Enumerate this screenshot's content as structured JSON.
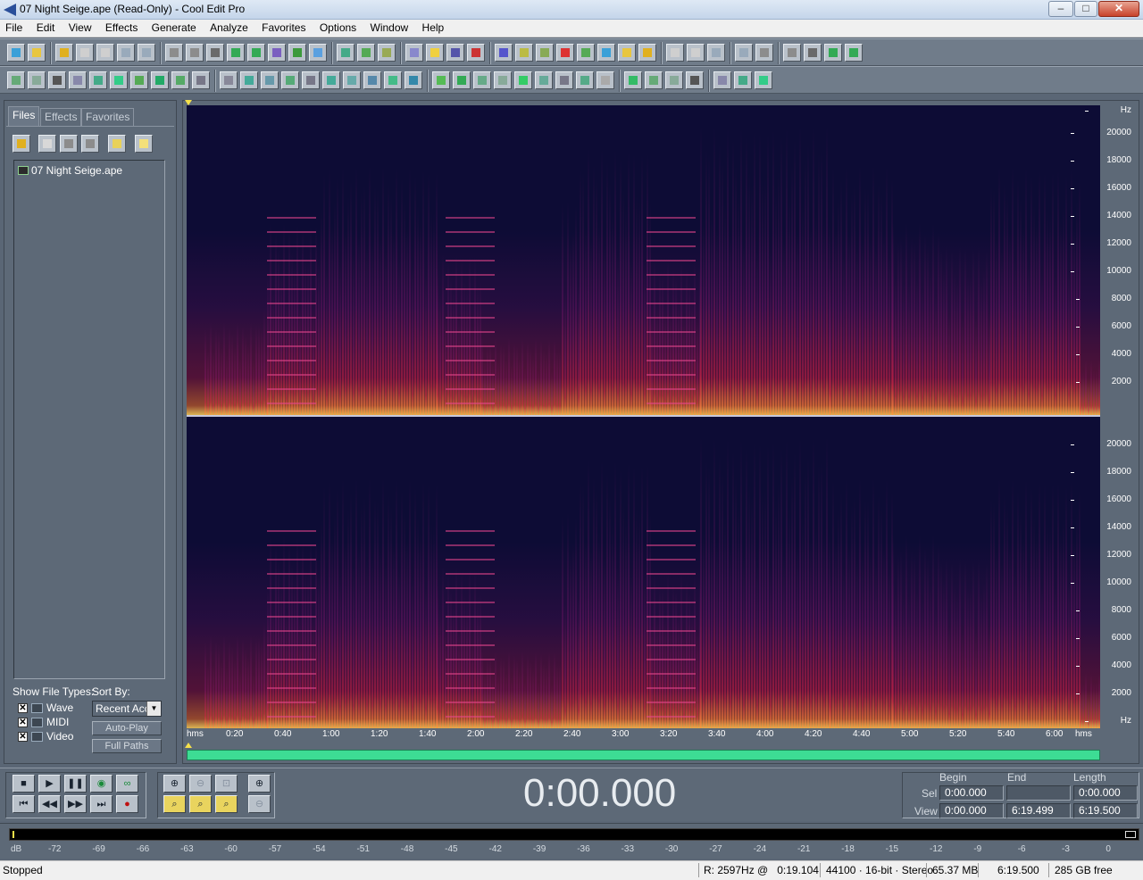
{
  "window": {
    "title": "07 Night Seige.ape (Read-Only) - Cool Edit Pro"
  },
  "menu": [
    "File",
    "Edit",
    "View",
    "Effects",
    "Generate",
    "Analyze",
    "Favorites",
    "Options",
    "Window",
    "Help"
  ],
  "panel": {
    "tabs": [
      "Files",
      "Effects",
      "Favorites"
    ],
    "files": [
      "07 Night Seige.ape"
    ],
    "show_file_types_label": "Show File Types:",
    "sort_by_label": "Sort By:",
    "types": [
      "Wave",
      "MIDI",
      "Video"
    ],
    "sort_value": "Recent Acc",
    "auto_play": "Auto-Play",
    "full_paths": "Full Paths"
  },
  "spectrogram": {
    "hz_labels_top": [
      "Hz",
      "20000",
      "18000",
      "16000",
      "14000",
      "12000",
      "10000",
      "8000",
      "6000",
      "4000",
      "2000"
    ],
    "hz_labels_bottom": [
      "20000",
      "18000",
      "16000",
      "14000",
      "12000",
      "10000",
      "8000",
      "6000",
      "4000",
      "2000",
      "Hz"
    ],
    "time_labels": [
      "hms",
      "0:20",
      "0:40",
      "1:00",
      "1:20",
      "1:40",
      "2:00",
      "2:20",
      "2:40",
      "3:00",
      "3:20",
      "3:40",
      "4:00",
      "4:20",
      "4:40",
      "5:00",
      "5:20",
      "5:40",
      "6:00",
      "hms"
    ]
  },
  "transport": {
    "time": "0:00.000",
    "col_begin": "Begin",
    "col_end": "End",
    "col_length": "Length",
    "sel_label": "Sel",
    "view_label": "View",
    "sel_begin": "0:00.000",
    "sel_end": "",
    "sel_length": "0:00.000",
    "view_begin": "0:00.000",
    "view_end": "6:19.499",
    "view_length": "6:19.500"
  },
  "meter_labels": [
    "dB",
    "-72",
    "-69",
    "-66",
    "-63",
    "-60",
    "-57",
    "-54",
    "-51",
    "-48",
    "-45",
    "-42",
    "-39",
    "-36",
    "-33",
    "-30",
    "-27",
    "-24",
    "-21",
    "-18",
    "-15",
    "-12",
    "-9",
    "-6",
    "-3",
    "0"
  ],
  "status": {
    "state": "Stopped",
    "cursor": "R: 2597Hz @   0:19.104",
    "format": "44100 · 16-bit · Stereo",
    "size": "65.37 MB",
    "duration": "6:19.500",
    "free": "285 GB free"
  },
  "colors": {
    "accent_green": "#3ddc94",
    "spectrogram_bg": "#0d0c35",
    "spectrogram_hot": "#ff5a28"
  }
}
